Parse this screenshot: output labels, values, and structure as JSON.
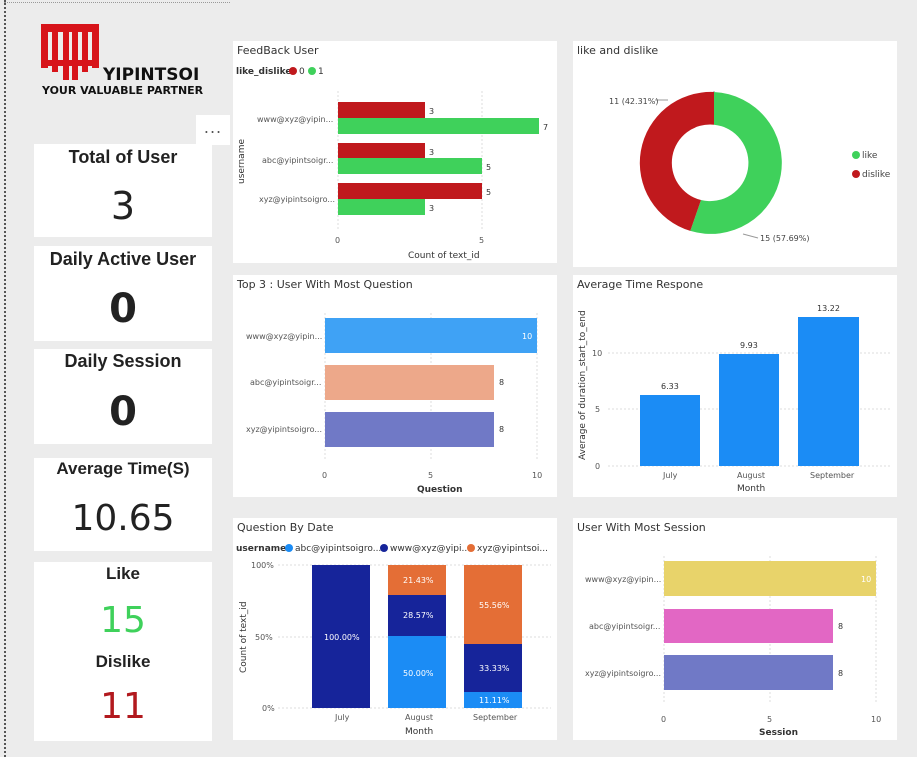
{
  "colors": {
    "like": "#3fd15b",
    "dislike": "#c0191d",
    "bar_blue": "#1b8cf5",
    "kpi_like": "#3fd15b",
    "kpi_dislike": "#b2191e",
    "logo_red": "#d7141a"
  },
  "logo": {
    "name": "YIPINTSOI",
    "tagline": "YOUR VALUABLE PARTNER"
  },
  "more_options_label": "...",
  "kpis": {
    "total_user": {
      "title": "Total of User",
      "value": "3"
    },
    "daily_active": {
      "title": "Daily Active User",
      "value": "0"
    },
    "daily_session": {
      "title": "Daily Session",
      "value": "0"
    },
    "avg_time": {
      "title": "Average Time(S)",
      "value": "10.65"
    },
    "like": {
      "title": "Like",
      "value": "15"
    },
    "dislike": {
      "title": "Dislike",
      "value": "11"
    }
  },
  "feedback_user": {
    "title": "FeedBack User",
    "legend_title": "like_dislike",
    "legend": [
      "0",
      "1"
    ],
    "ylabel": "username",
    "xlabel": "Count of text_id",
    "ticks": [
      "0",
      "5"
    ],
    "rows": [
      {
        "user": "www@xyz@yipin...",
        "dislike": "3",
        "like": "7"
      },
      {
        "user": "abc@yipintsoigr...",
        "dislike": "3",
        "like": "5"
      },
      {
        "user": "xyz@yipintsoigro...",
        "dislike": "5",
        "like": "3"
      }
    ]
  },
  "like_dislike": {
    "title": "like and dislike",
    "slices": [
      {
        "name": "like",
        "value": 15,
        "label": "15 (57.69%)"
      },
      {
        "name": "dislike",
        "value": 11,
        "label": "11 (42.31%)"
      }
    ]
  },
  "top3_questions": {
    "title": "Top 3 : User With Most Question",
    "xlabel": "Question",
    "ticks": [
      "0",
      "5",
      "10"
    ],
    "rows": [
      {
        "user": "www@xyz@yipin...",
        "value": "10",
        "color": "#3fa2f5"
      },
      {
        "user": "abc@yipintsoigr...",
        "value": "8",
        "color": "#eda88a"
      },
      {
        "user": "xyz@yipintsoigro...",
        "value": "8",
        "color": "#7079c6"
      }
    ]
  },
  "avg_time_response": {
    "title": "Average Time Respone",
    "ylabel": "Average of duration_start_to_end",
    "xlabel": "Month",
    "yticks": [
      "0",
      "5",
      "10"
    ],
    "bars": [
      {
        "month": "July",
        "value": "6.33"
      },
      {
        "month": "August",
        "value": "9.93"
      },
      {
        "month": "September",
        "value": "13.22"
      }
    ]
  },
  "question_by_date": {
    "title": "Question By Date",
    "legend_title": "username",
    "legend": [
      {
        "name": "abc@yipintsoigro...",
        "color": "#1b8cf5"
      },
      {
        "name": "www@xyz@yipi...",
        "color": "#16249a"
      },
      {
        "name": "xyz@yipintsoi...",
        "color": "#e46e36"
      }
    ],
    "ylabel": "Count of text_id",
    "xlabel": "Month",
    "yticks": [
      "0%",
      "50%",
      "100%"
    ],
    "columns": [
      {
        "month": "July",
        "segments": [
          {
            "value": "100.00%",
            "color": "#16249a"
          }
        ]
      },
      {
        "month": "August",
        "segments": [
          {
            "value": "50.00%",
            "color": "#1b8cf5"
          },
          {
            "value": "28.57%",
            "color": "#16249a"
          },
          {
            "value": "21.43%",
            "color": "#e46e36"
          }
        ]
      },
      {
        "month": "September",
        "segments": [
          {
            "value": "11.11%",
            "color": "#1b8cf5"
          },
          {
            "value": "33.33%",
            "color": "#16249a"
          },
          {
            "value": "55.56%",
            "color": "#e46e36"
          }
        ]
      }
    ]
  },
  "most_session": {
    "title": "User With Most Session",
    "xlabel": "Session",
    "ticks": [
      "0",
      "5",
      "10"
    ],
    "rows": [
      {
        "user": "www@xyz@yipin...",
        "value": "10",
        "color": "#e8d36a"
      },
      {
        "user": "abc@yipintsoigr...",
        "value": "8",
        "color": "#e267c4"
      },
      {
        "user": "xyz@yipintsoigro...",
        "value": "8",
        "color": "#7079c6"
      }
    ]
  },
  "chart_data": [
    {
      "type": "bar",
      "title": "FeedBack User",
      "categories": [
        "www@xyz@yipin...",
        "abc@yipintsoigr...",
        "xyz@yipintsoigro..."
      ],
      "series": [
        {
          "name": "0",
          "values": [
            3,
            3,
            5
          ]
        },
        {
          "name": "1",
          "values": [
            7,
            5,
            3
          ]
        }
      ],
      "xlabel": "Count of text_id",
      "ylabel": "username",
      "xlim": [
        0,
        7.5
      ],
      "grid": true,
      "legend": "top-left"
    },
    {
      "type": "pie",
      "title": "like and dislike",
      "categories": [
        "like",
        "dislike"
      ],
      "values": [
        15,
        11
      ],
      "legend": "right"
    },
    {
      "type": "bar",
      "title": "Top 3 : User With Most Question",
      "categories": [
        "www@xyz@yipin...",
        "abc@yipintsoigr...",
        "xyz@yipintsoigro..."
      ],
      "values": [
        10,
        8,
        8
      ],
      "xlabel": "Question",
      "xlim": [
        0,
        10
      ],
      "grid": true
    },
    {
      "type": "bar",
      "title": "Average Time Respone",
      "categories": [
        "July",
        "August",
        "September"
      ],
      "values": [
        6.33,
        9.93,
        13.22
      ],
      "xlabel": "Month",
      "ylabel": "Average of duration_start_to_end",
      "ylim": [
        0,
        14
      ],
      "grid": true
    },
    {
      "type": "bar",
      "title": "Question By Date",
      "categories": [
        "July",
        "August",
        "September"
      ],
      "series": [
        {
          "name": "abc@yipintsoigro...",
          "values": [
            0,
            50.0,
            11.11
          ]
        },
        {
          "name": "www@xyz@yipi...",
          "values": [
            100.0,
            28.57,
            33.33
          ]
        },
        {
          "name": "xyz@yipintsoi...",
          "values": [
            0,
            21.43,
            55.56
          ]
        }
      ],
      "xlabel": "Month",
      "ylabel": "Count of text_id",
      "ylim": [
        0,
        100
      ],
      "stacked": true,
      "grid": true,
      "legend": "top-left"
    },
    {
      "type": "bar",
      "title": "User With Most Session",
      "categories": [
        "www@xyz@yipin...",
        "abc@yipintsoigr...",
        "xyz@yipintsoigro..."
      ],
      "values": [
        10,
        8,
        8
      ],
      "xlabel": "Session",
      "xlim": [
        0,
        10
      ],
      "grid": true
    }
  ]
}
